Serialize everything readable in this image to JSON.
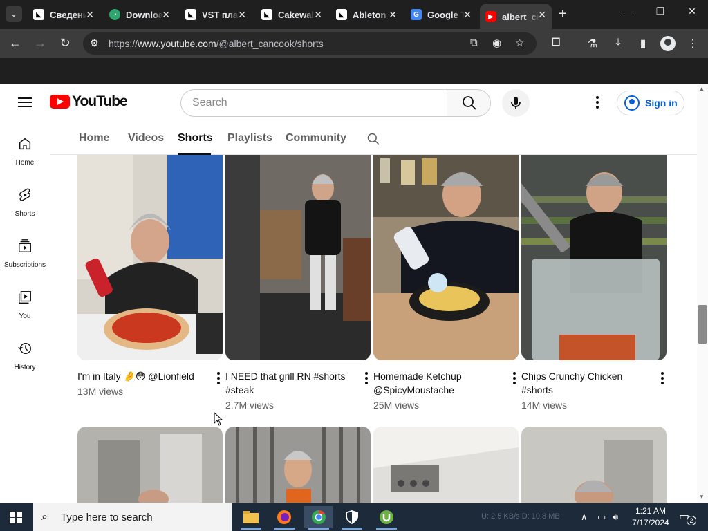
{
  "browser": {
    "tabs": [
      {
        "label": "Сведения",
        "icon": "vst-site-icon"
      },
      {
        "label": "Downloads",
        "icon": "download-site-icon"
      },
      {
        "label": "VST плагины",
        "icon": "vst-site-icon"
      },
      {
        "label": "Cakewalk",
        "icon": "vst-site-icon"
      },
      {
        "label": "Ableton",
        "icon": "vst-site-icon"
      },
      {
        "label": "Google Translate",
        "icon": "google-translate-icon"
      },
      {
        "label": "albert_cancook",
        "icon": "youtube-icon"
      }
    ],
    "url_prefix": "https://",
    "url_domain": "www.youtube.com",
    "url_path": "/@albert_cancook/shorts"
  },
  "youtube": {
    "logo_text": "YouTube",
    "search_placeholder": "Search",
    "sign_in_label": "Sign in",
    "sidebar": [
      {
        "label": "Home",
        "icon": "home-icon"
      },
      {
        "label": "Shorts",
        "icon": "shorts-icon"
      },
      {
        "label": "Subscriptions",
        "icon": "subscriptions-icon"
      },
      {
        "label": "You",
        "icon": "you-icon"
      },
      {
        "label": "History",
        "icon": "history-icon"
      }
    ],
    "channel_tabs": [
      "Home",
      "Videos",
      "Shorts",
      "Playlists",
      "Community"
    ],
    "active_tab": "Shorts",
    "shorts": [
      {
        "title": "I'm in Italy 🤌😳 @Lionfield",
        "views": "13M views"
      },
      {
        "title": "I NEED that grill RN #shorts #steak",
        "views": "2.7M views"
      },
      {
        "title": "Homemade Ketchup @SpicyMoustache",
        "views": "25M views"
      },
      {
        "title": "Chips Crunchy Chicken #shorts",
        "views": "14M views"
      }
    ]
  },
  "taskbar": {
    "search_text": "Type here to search",
    "network_ghost": "U: 2.5 KB/s  D: 10.8 MB",
    "time": "1:21 AM",
    "date": "7/17/2024",
    "notification_count": "2"
  }
}
